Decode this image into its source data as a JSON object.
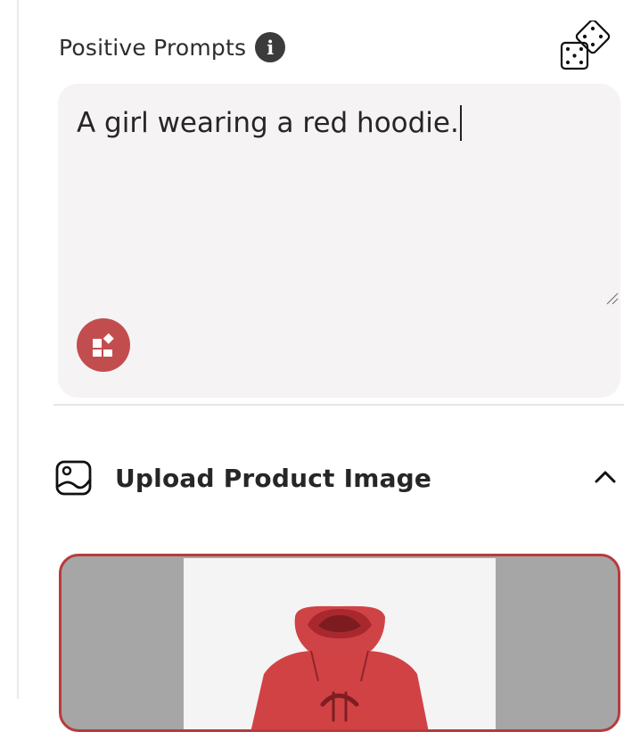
{
  "prompt": {
    "heading": "Positive Prompts",
    "info_icon": "info-icon",
    "info_glyph": "i",
    "randomize_icon": "dice-icon",
    "text": "A girl wearing a red hoodie.",
    "enhance_icon": "widgets-icon",
    "enhance_color": "#c24d4f",
    "background_color": "#f5f3f3"
  },
  "upload": {
    "heading": "Upload Product Image",
    "icon": "image-icon",
    "toggle_icon": "chevron-up-icon",
    "preview_icon": "red-hoodie-image",
    "card_border_color": "#b73b3e"
  }
}
